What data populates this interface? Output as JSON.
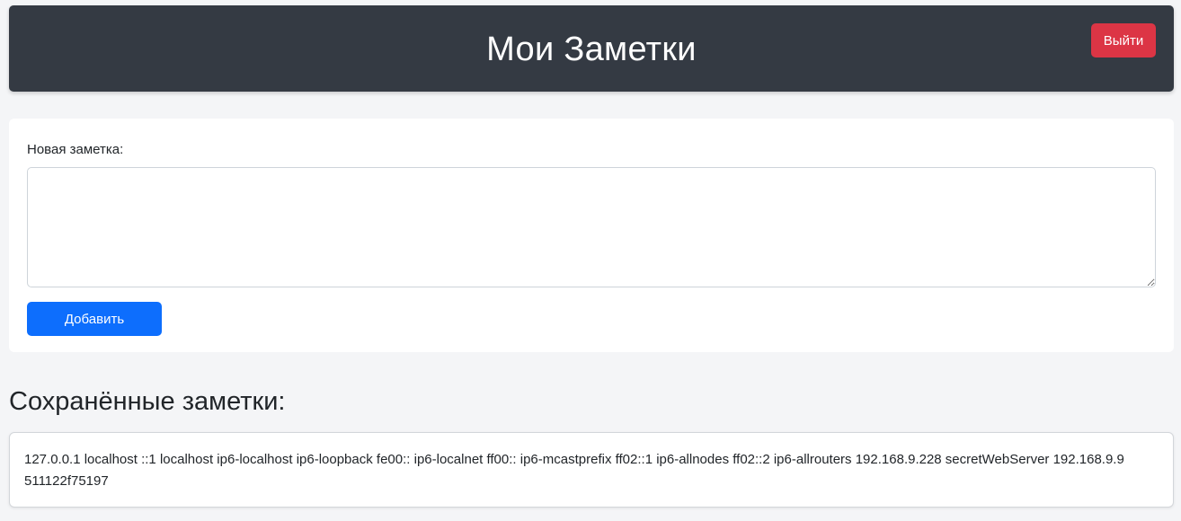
{
  "header": {
    "title": "Мои Заметки",
    "logout_label": "Выйти"
  },
  "form": {
    "label": "Новая заметка:",
    "textarea_value": "",
    "add_label": "Добавить"
  },
  "saved": {
    "title": "Сохранённые заметки:",
    "notes": [
      "127.0.0.1 localhost ::1 localhost ip6-localhost ip6-loopback fe00:: ip6-localnet ff00:: ip6-mcastprefix ff02::1 ip6-allnodes ff02::2 ip6-allrouters 192.168.9.228 secretWebServer 192.168.9.9 511122f75197"
    ]
  },
  "colors": {
    "header_bg": "#343a43",
    "logout": "#dc3545",
    "primary": "#0d6efd",
    "page_bg": "#f4f5f7"
  }
}
